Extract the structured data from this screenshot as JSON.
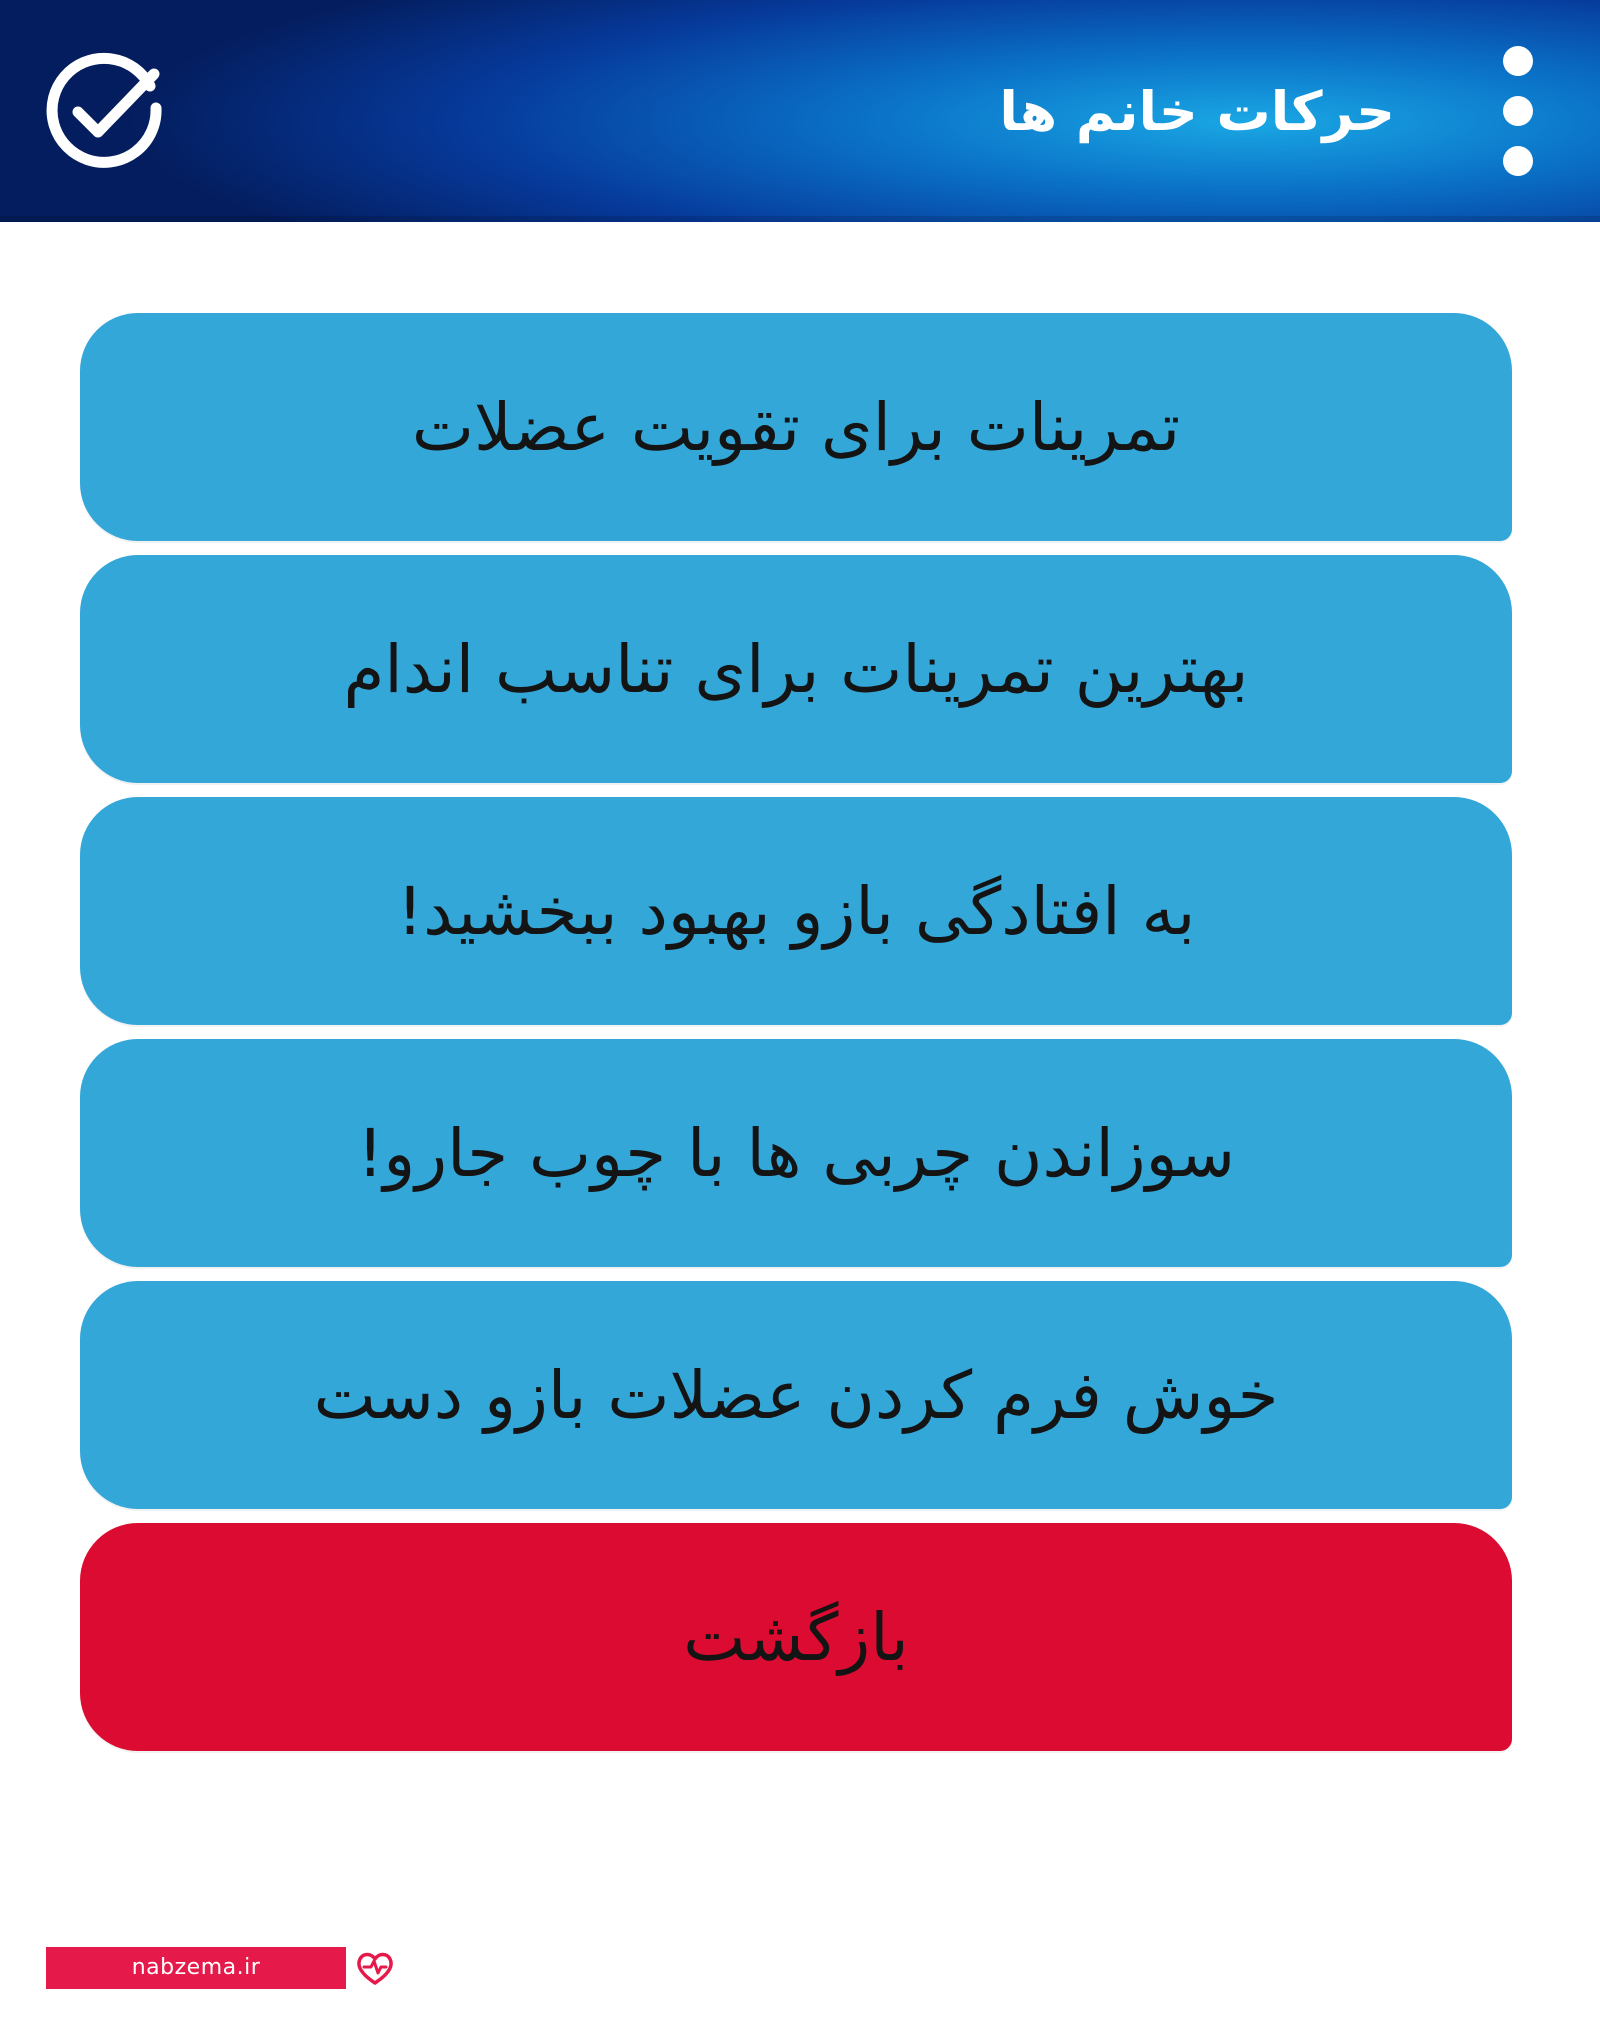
{
  "app_bar": {
    "title": "حرکات خانم ها",
    "left_icon": "check-circle-icon",
    "right_icon": "more-vert-icon",
    "colors": [
      "#041d5e",
      "#0a70c6",
      "#1aa7e4"
    ]
  },
  "menu": {
    "items": [
      {
        "label": "تمرینات برای تقویت عضلات"
      },
      {
        "label": "بهترین تمرینات برای تناسب اندام"
      },
      {
        "label": "به افتادگی بازو بهبود ببخشید!"
      },
      {
        "label": "سوزاندن چربی ها با چوب جارو!"
      },
      {
        "label": "خوش فرم کردن عضلات بازو دست"
      }
    ],
    "back_label": "بازگشت",
    "item_color": "#34a7d9",
    "back_color": "#dc0b31"
  },
  "watermark": {
    "text": "nabzema.ir",
    "icon": "heart-pulse-icon",
    "color": "#e6194b"
  }
}
